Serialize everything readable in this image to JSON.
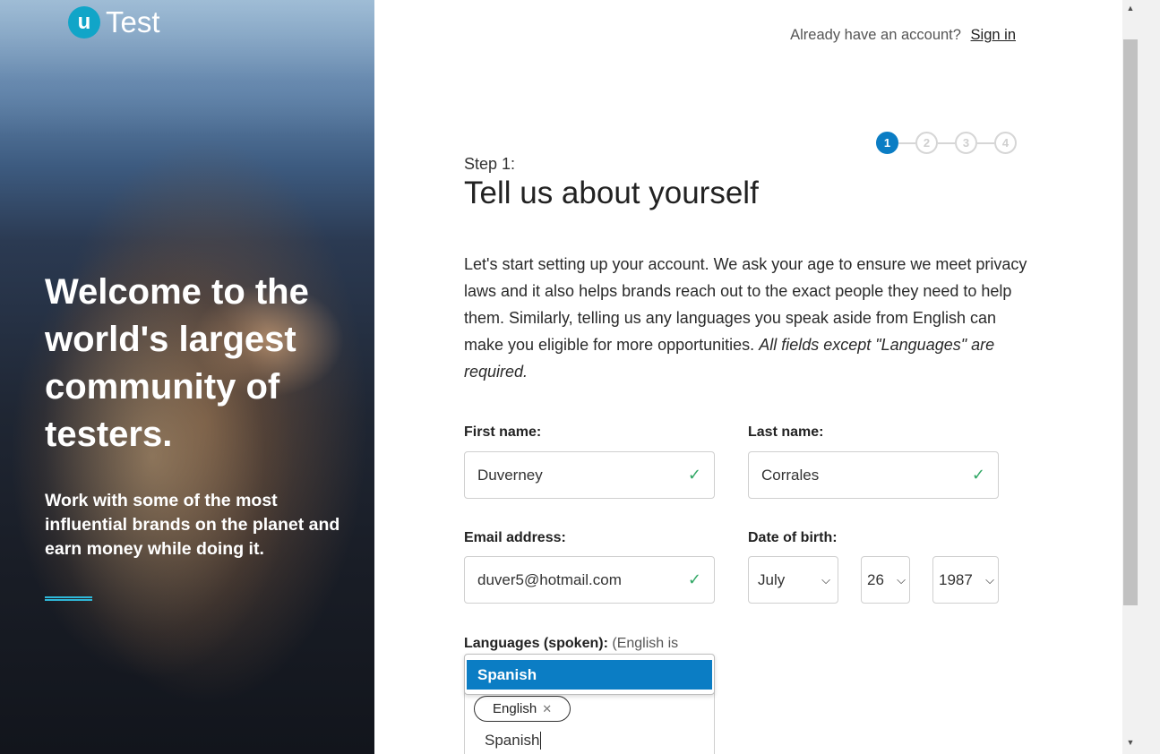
{
  "brand": {
    "logo_letter": "u",
    "logo_text": "Test"
  },
  "hero": {
    "title": "Welcome to the world's largest community of testers.",
    "subtitle": "Work with some of the most influential brands on the planet and earn money while doing it."
  },
  "header": {
    "account_prompt": "Already have an account?",
    "signin_label": "Sign in"
  },
  "steps": {
    "items": [
      "1",
      "2",
      "3",
      "4"
    ],
    "current": 1
  },
  "form": {
    "step_label": "Step 1:",
    "title": "Tell us about yourself",
    "intro_text": "Let's start setting up your account. We ask your age to ensure we meet privacy laws and it also helps brands reach out to the exact people they need to help them. Similarly, telling us any languages you speak aside from English can make you eligible for more opportunities.",
    "intro_note": "All fields except \"Languages\" are required.",
    "first_name": {
      "label": "First name:",
      "value": "Duverney",
      "valid": true
    },
    "last_name": {
      "label": "Last name:",
      "value": "Corrales",
      "valid": true
    },
    "email": {
      "label": "Email address:",
      "value": "duver5@hotmail.com",
      "valid": true
    },
    "dob": {
      "label": "Date of birth:",
      "month": "July",
      "day": "26",
      "year": "1987"
    },
    "languages": {
      "label": "Languages (spoken):",
      "note": "(English is",
      "tags": [
        "English"
      ],
      "input_value": "Spanish",
      "suggestion": "Spanish"
    }
  },
  "icons": {
    "check": "check-icon",
    "chevron": "chevron-down-icon",
    "remove": "close-icon"
  },
  "colors": {
    "accent": "#0b7dc4",
    "valid": "#32a866",
    "logo": "#11a5c8"
  }
}
